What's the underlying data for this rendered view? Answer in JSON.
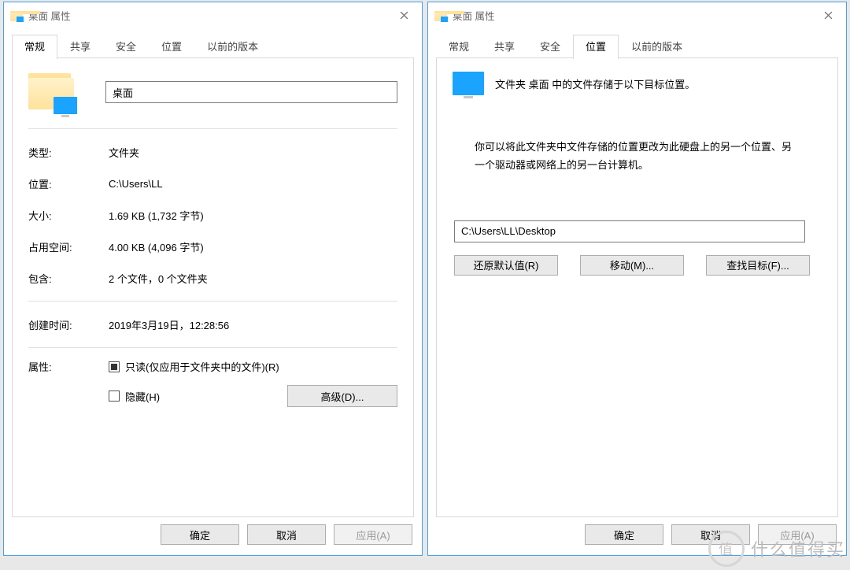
{
  "left_dialog": {
    "title": "桌面 属性",
    "tabs": [
      "常规",
      "共享",
      "安全",
      "位置",
      "以前的版本"
    ],
    "active_tab": 0,
    "folder_name": "桌面",
    "rows": {
      "type_label": "类型:",
      "type_value": "文件夹",
      "location_label": "位置:",
      "location_value": "C:\\Users\\LL",
      "size_label": "大小:",
      "size_value": "1.69 KB (1,732 字节)",
      "size_on_disk_label": "占用空间:",
      "size_on_disk_value": "4.00 KB (4,096 字节)",
      "contains_label": "包含:",
      "contains_value": "2 个文件，0 个文件夹",
      "created_label": "创建时间:",
      "created_value": "2019年3月19日，12:28:56",
      "attrs_label": "属性:"
    },
    "readonly_label": "只读(仅应用于文件夹中的文件)(R)",
    "hidden_label": "隐藏(H)",
    "advanced_btn": "高级(D)..."
  },
  "right_dialog": {
    "title": "桌面 属性",
    "tabs": [
      "常规",
      "共享",
      "安全",
      "位置",
      "以前的版本"
    ],
    "active_tab": 3,
    "heading": "文件夹 桌面 中的文件存储于以下目标位置。",
    "body": "你可以将此文件夹中文件存储的位置更改为此硬盘上的另一个位置、另一个驱动器或网络上的另一台计算机。",
    "path_value": "C:\\Users\\LL\\Desktop",
    "restore_btn": "还原默认值(R)",
    "move_btn": "移动(M)...",
    "find_btn": "查找目标(F)..."
  },
  "common_buttons": {
    "ok": "确定",
    "cancel": "取消",
    "apply": "应用(A)"
  },
  "watermark": {
    "badge": "值",
    "text": "什么值得买"
  }
}
